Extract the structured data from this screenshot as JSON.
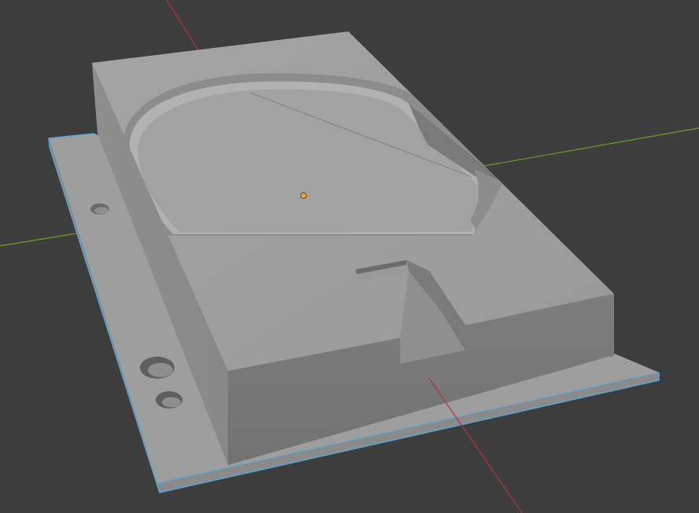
{
  "viewport": {
    "background": "#3d3d3d",
    "axis_x_color": "#b3323f",
    "axis_y_color": "#6c9a2a",
    "selection_outline_color": "#5aa8d8",
    "origin_marker_color": "#f2a33a"
  },
  "scene": {
    "objects": [
      {
        "name": "base-plate",
        "selected": true
      },
      {
        "name": "mold-block",
        "selected": false
      }
    ],
    "origin_icon": "origin-point-icon"
  }
}
